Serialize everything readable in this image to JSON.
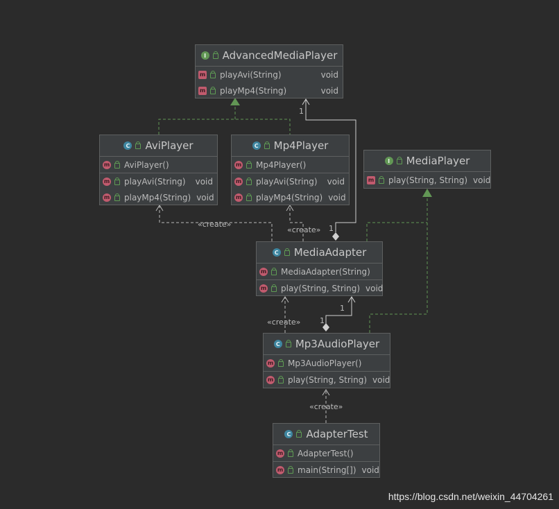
{
  "classes": {
    "advanced_media_player": {
      "name": "AdvancedMediaPlayer",
      "kind": "I",
      "members": [
        [
          {
            "name": "playAvi(String)",
            "ret": "void"
          },
          {
            "name": "playMp4(String)",
            "ret": "void"
          }
        ]
      ]
    },
    "avi_player": {
      "name": "AviPlayer",
      "kind": "C",
      "members": [
        [
          {
            "name": "AviPlayer()",
            "ret": ""
          }
        ],
        [
          {
            "name": "playAvi(String)",
            "ret": "void"
          },
          {
            "name": "playMp4(String)",
            "ret": "void"
          }
        ]
      ]
    },
    "mp4_player": {
      "name": "Mp4Player",
      "kind": "C",
      "members": [
        [
          {
            "name": "Mp4Player()",
            "ret": ""
          }
        ],
        [
          {
            "name": "playAvi(String)",
            "ret": "void"
          },
          {
            "name": "playMp4(String)",
            "ret": "void"
          }
        ]
      ]
    },
    "media_player": {
      "name": "MediaPlayer",
      "kind": "I",
      "members": [
        [
          {
            "name": "play(String, String)",
            "ret": "void"
          }
        ]
      ]
    },
    "media_adapter": {
      "name": "MediaAdapter",
      "kind": "C",
      "members": [
        [
          {
            "name": "MediaAdapter(String)",
            "ret": ""
          }
        ],
        [
          {
            "name": "play(String, String)",
            "ret": "void"
          }
        ]
      ]
    },
    "mp3_audio_player": {
      "name": "Mp3AudioPlayer",
      "kind": "C",
      "members": [
        [
          {
            "name": "Mp3AudioPlayer()",
            "ret": ""
          }
        ],
        [
          {
            "name": "play(String, String)",
            "ret": "void"
          }
        ]
      ]
    },
    "adapter_test": {
      "name": "AdapterTest",
      "kind": "C",
      "members": [
        [
          {
            "name": "AdapterTest()",
            "ret": ""
          }
        ],
        [
          {
            "name": "main(String[])",
            "ret": "void"
          }
        ]
      ]
    }
  },
  "labels": {
    "create": "«create»",
    "multiplicity": "1"
  },
  "colors": {
    "background": "#2b2b2b",
    "box": "#3c3f41",
    "realization": "#629755",
    "dependency": "#bbbbbb",
    "association": "#d0d0d0"
  },
  "watermark": "https://blog.csdn.net/weixin_44704261"
}
